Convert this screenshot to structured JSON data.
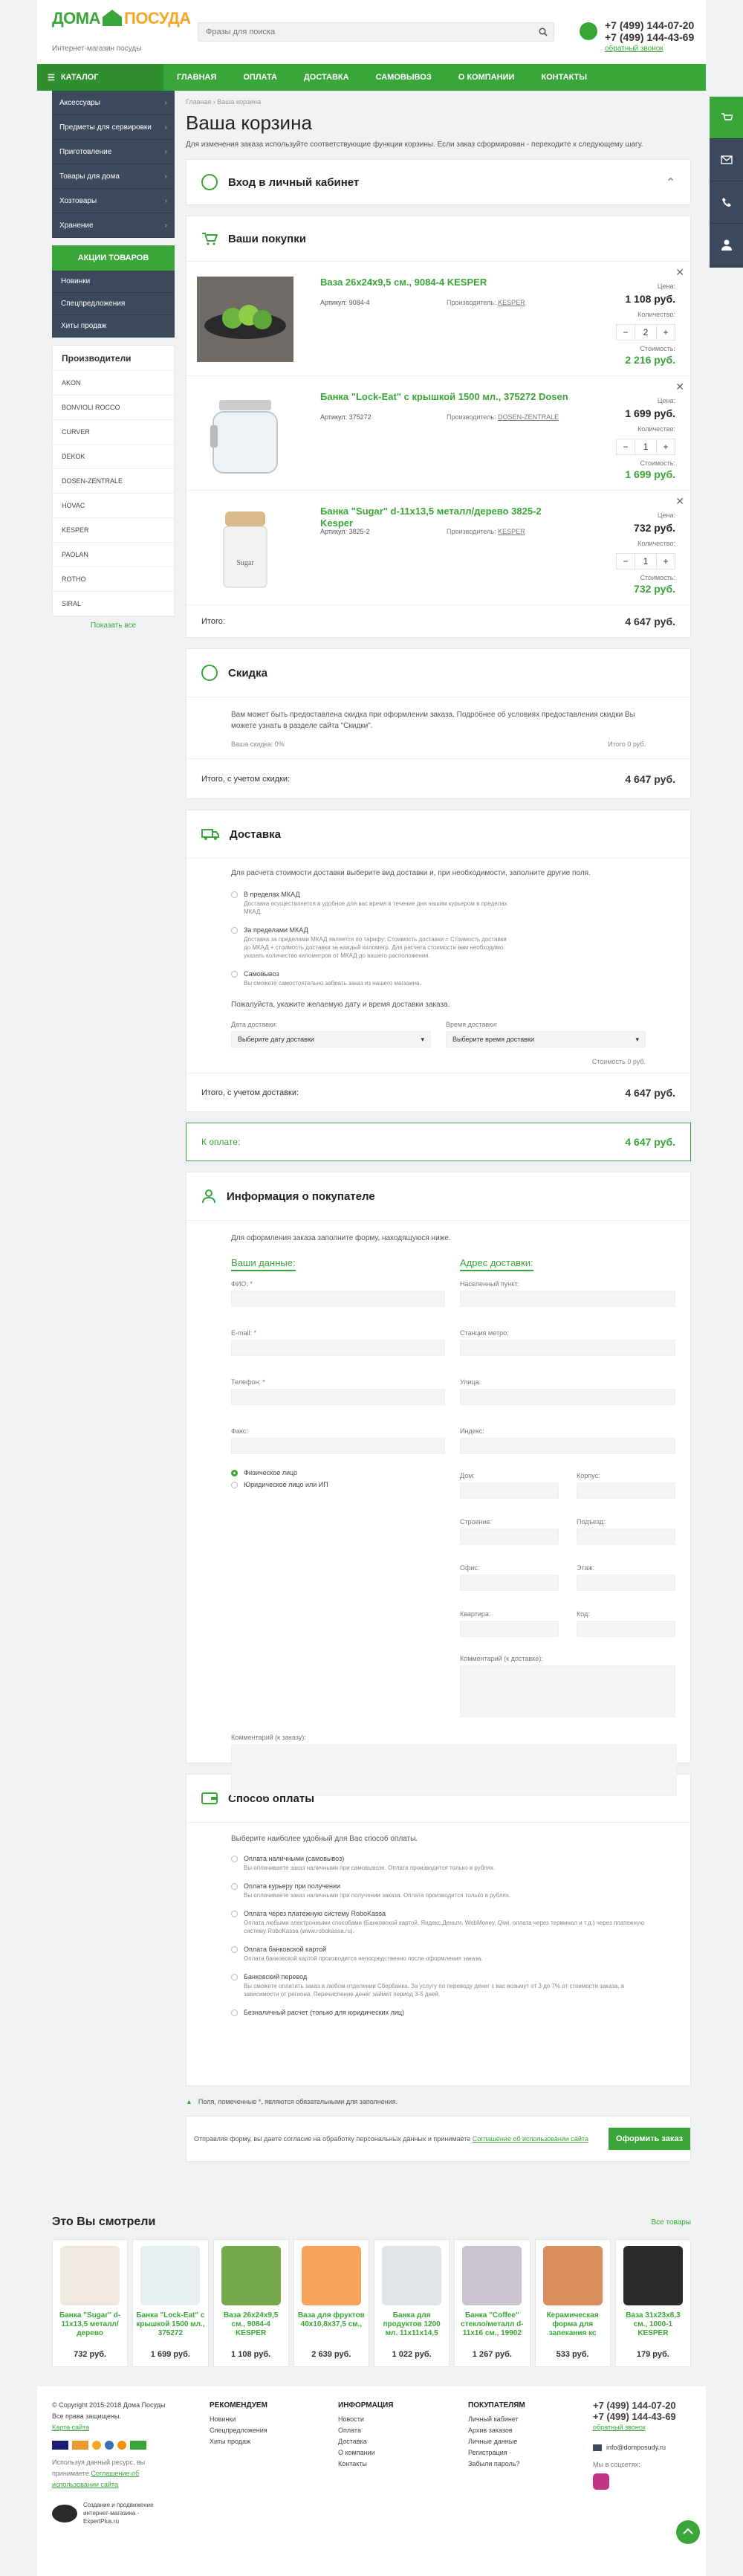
{
  "header": {
    "logo_main": "ДОМА",
    "logo_sub": "ПОСУДА",
    "tagline": "Интернет-магазин посуды",
    "search_placeholder": "Фразы для поиска",
    "phone1": "+7 (499) 144-07-20",
    "phone2": "+7 (499) 144-43-69",
    "callback": "обратный звонок"
  },
  "nav": {
    "catalog": "КАТАЛОГ",
    "items": [
      "ГЛАВНАЯ",
      "ОПЛАТА",
      "ДОСТАВКА",
      "САМОВЫВОЗ",
      "О КОМПАНИИ",
      "КОНТАКТЫ"
    ]
  },
  "sidebar": {
    "categories": [
      "Аксессуары",
      "Предметы для сервировки",
      "Приготовление",
      "Товары для дома",
      "Хозтовары",
      "Хранение"
    ],
    "promo_title": "АКЦИИ ТОВАРОВ",
    "promo_items": [
      "Новинки",
      "Спецпредложения",
      "Хиты продаж"
    ],
    "mfg_title": "Производители",
    "mfg_items": [
      "AKON",
      "BONVIOLI ROCCO",
      "CURVER",
      "DEKOK",
      "DOSEN-ZENTRALE",
      "HOVAC",
      "KESPER",
      "PAOLAN",
      "ROTHO",
      "SIRAL"
    ],
    "show_all": "Показать все"
  },
  "breadcrumb": [
    "Главная",
    "Ваша корзина"
  ],
  "page_title": "Ваша корзина",
  "lead": "Для изменения заказа используйте соответствующие функции корзины. Если заказ сформирован - переходите к следующему шагу.",
  "login": {
    "title": "Вход в личный кабинет"
  },
  "cart": {
    "title": "Ваши покупки",
    "price_label": "Цена:",
    "qty_label": "Количество:",
    "sum_label": "Стоимость:",
    "article_label": "Артикул:",
    "maker_label": "Производитель:",
    "items": [
      {
        "name": "Ваза 26х24х9,5 см., 9084-4 KESPER",
        "article": "9084-4",
        "maker": "KESPER",
        "price": "1 108 руб.",
        "qty": "2",
        "sum": "2 216 руб."
      },
      {
        "name": "Банка \"Lock-Eat\" с крышкой 1500 мл., 375272 Dosen",
        "article": "375272",
        "maker": "DOSEN-ZENTRALE",
        "price": "1 699 руб.",
        "qty": "1",
        "sum": "1 699 руб."
      },
      {
        "name": "Банка \"Sugar\" d-11х13,5 металл/дерево 3825-2 Kesper",
        "article": "3825-2",
        "maker": "KESPER",
        "price": "732 руб.",
        "qty": "1",
        "sum": "732 руб."
      }
    ],
    "total_label": "Итого:",
    "total": "4 647 руб."
  },
  "discount": {
    "title": "Скидка",
    "text": "Вам может быть предоставлена скидка при оформлении заказа. Подробнее об условиях предоставления скидки Вы можете узнать в разделе сайта \"Скидки\".",
    "your_discount": "Ваша скидка: 0%",
    "sum": "Итого 0 руб.",
    "total_label": "Итого, с учетом скидки:",
    "total": "4 647 руб."
  },
  "delivery": {
    "title": "Доставка",
    "intro": "Для расчета стоимости доставки выберите вид доставки и, при необходимости, заполните другие поля.",
    "options": [
      {
        "title": "В пределах МКАД",
        "desc": "Доставка осуществляется в удобное для вас время в течение дня нашим курьером в пределах МКАД."
      },
      {
        "title": "За пределами МКАД",
        "desc": "Доставка за пределами МКАД является по тарифу: Стоимость доставки = Стоимость доставки до МКАД + стоимость доставки за каждый километр. Для расчета стоимости вам необходимо указать количество километров от МКАД до вашего расположения."
      },
      {
        "title": "Самовывоз",
        "desc": "Вы сможете самостоятельно забрать заказ из нашего магазина."
      }
    ],
    "date_hint": "Пожалуйста, укажите желаемую дату и время доставки заказа.",
    "date_label": "Дата доставки:",
    "date_value": "Выберите дату доставки",
    "time_label": "Время доставки:",
    "time_value": "Выберите время доставки",
    "cost": "Стоимость 0 руб.",
    "total_label": "Итого, с учетом доставки:",
    "total": "4 647 руб."
  },
  "to_pay": {
    "label": "К оплате:",
    "value": "4 647 руб."
  },
  "buyer": {
    "title": "Информация о покупателе",
    "intro": "Для оформления заказа заполните форму, находящуюся ниже.",
    "col1_title": "Ваши данные:",
    "col2_title": "Адрес доставки:",
    "fio": "ФИО: *",
    "email": "E-mail: *",
    "phone": "Телефон: *",
    "fax": "Факс:",
    "person_phys": "Физическое лицо",
    "person_jur": "Юридическое лицо или ИП",
    "city": "Населенный пункт:",
    "street_label": "Станция метро:",
    "street": "Улица:",
    "index": "Индекс:",
    "house": "Дом:",
    "korpus": "Корпус:",
    "building": "Строение:",
    "entrance": "Подъезд:",
    "office": "Офис:",
    "floor": "Этаж:",
    "apartment": "Квартира:",
    "code": "Код:",
    "delivery_comment": "Комментарий (к доставке):",
    "order_comment": "Комментарий (к заказу):"
  },
  "payment": {
    "title": "Способ оплаты",
    "intro": "Выберите наиболее удобный для Вас способ оплаты.",
    "options": [
      {
        "title": "Оплата наличными (самовывоз)",
        "desc": "Вы оплачиваете заказ наличными при самовывозе. Оплата производится только в рублях."
      },
      {
        "title": "Оплата курьеру при получении",
        "desc": "Вы оплачиваете заказ наличными при получении заказа. Оплата производится только в рублях."
      },
      {
        "title": "Оплата через платежную систему RoboKassa",
        "desc": "Оплата любыми электронными способами (Банковской картой, Яндекс.Деньги, WebMoney, Qiwi, оплата через терминал и т.д.) через платежную систему RoboKassa (www.robokassa.ru)."
      },
      {
        "title": "Оплата банковской картой",
        "desc": "Оплата банковской картой производится непосредственно после оформления заказа."
      },
      {
        "title": "Банковский перевод",
        "desc": "Вы сможете оплатить заказ в любом отделении Сбербанка. За услугу по переводу денег с вас возьмут от 3 до 7% от стоимости заказа, в зависимости от региона. Перечисление денег займет период 3-5 дней."
      },
      {
        "title": "Безналичный расчет (только для юридических лиц)",
        "desc": ""
      }
    ]
  },
  "required_note": "Поля, помеченные *, являются обязательными для заполнения.",
  "consent": "Отправляя форму, вы даете согласие на обработку персональных данных и принимаете",
  "consent_link": "Соглашение об использовании сайта",
  "submit": "Оформить заказ",
  "viewed": {
    "title": "Это Вы смотрели",
    "all": "Все товары",
    "items": [
      {
        "name": "Банка \"Sugar\" d-11х13,5 металл/дерево",
        "price": "732 руб."
      },
      {
        "name": "Банка \"Lock-Eat\" с крышкой 1500 мл., 375272",
        "price": "1 699 руб."
      },
      {
        "name": "Ваза 26х24х9,5 см., 9084-4 KESPER",
        "price": "1 108 руб."
      },
      {
        "name": "Ваза для фруктов 40х10,8х37,5 см.,",
        "price": "2 639 руб."
      },
      {
        "name": "Банка для продуктов 1200 мл. 11х11х14,5",
        "price": "1 022 руб."
      },
      {
        "name": "Банка \"Coffee\" стекло/металл d-11х16 см., 19902",
        "price": "1 267 руб."
      },
      {
        "name": "Керамическая форма для запекания кс",
        "price": "533 руб."
      },
      {
        "name": "Ваза 31х23х8,3 см., 1000-1 KESPER",
        "price": "179 руб."
      }
    ]
  },
  "footer": {
    "copyright": "© Copyright 2015-2018 Дома Посуды",
    "rights": "Все права защищены.",
    "sitemap": "Карта сайта",
    "personal": "Используя данный ресурс, вы принимаете",
    "personal_link": "Соглашение об использовании сайта",
    "dev1": "Создание и продвижение",
    "dev2": "интернет-магазина -",
    "dev3": "ExpertPlus.ru",
    "col_rec": {
      "title": "РЕКОМЕНДУЕМ",
      "links": [
        "Новинки",
        "Спецпредложения",
        "Хиты продаж"
      ]
    },
    "col_info": {
      "title": "ИНФОРМАЦИЯ",
      "links": [
        "Новости",
        "Оплата",
        "Доставка",
        "О компании",
        "Контакты"
      ]
    },
    "col_buy": {
      "title": "ПОКУПАТЕЛЯМ",
      "links": [
        "Личный кабинет",
        "Архив заказов",
        "Личные данные",
        "Регистрация",
        "Забыли пароль?"
      ]
    },
    "phone1": "+7 (499) 144-07-20",
    "phone2": "+7 (499) 144-43-69",
    "callback": "обратный звонок",
    "email": "info@domposudy.ru",
    "social": "Мы в соцсетях:"
  },
  "colors": {
    "accent": "#3aa639",
    "dark": "#3a4a5c"
  }
}
